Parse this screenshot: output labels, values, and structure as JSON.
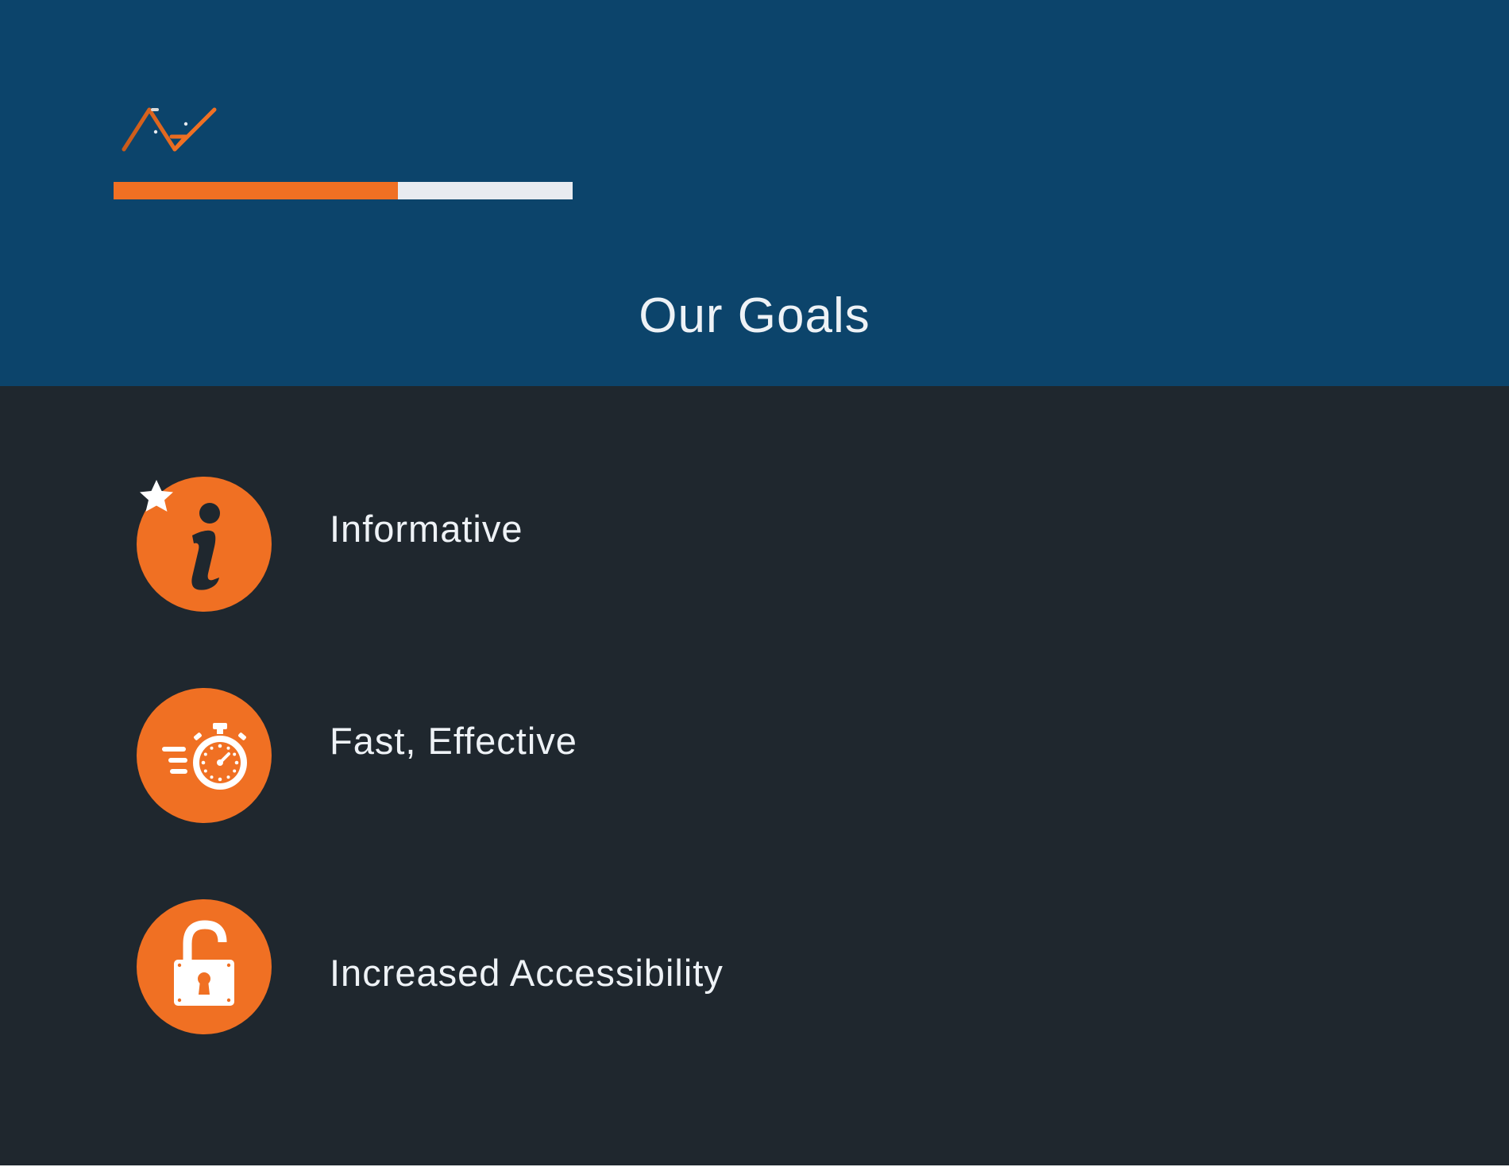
{
  "header": {
    "logo_icon": "chevron-wave-logo",
    "progress": {
      "value": 0.62
    },
    "title": "Our Goals"
  },
  "goals": [
    {
      "label": "Informative",
      "icon": "info-star-icon"
    },
    {
      "label": "Fast, Effective",
      "icon": "stopwatch-icon"
    },
    {
      "label": "Increased Accessibility",
      "icon": "unlock-icon"
    }
  ],
  "colors": {
    "header_bg": "#0c446b",
    "content_bg": "#1f272e",
    "accent": "#f07023",
    "track": "#e8ebf0",
    "text": "#eef2f6"
  }
}
